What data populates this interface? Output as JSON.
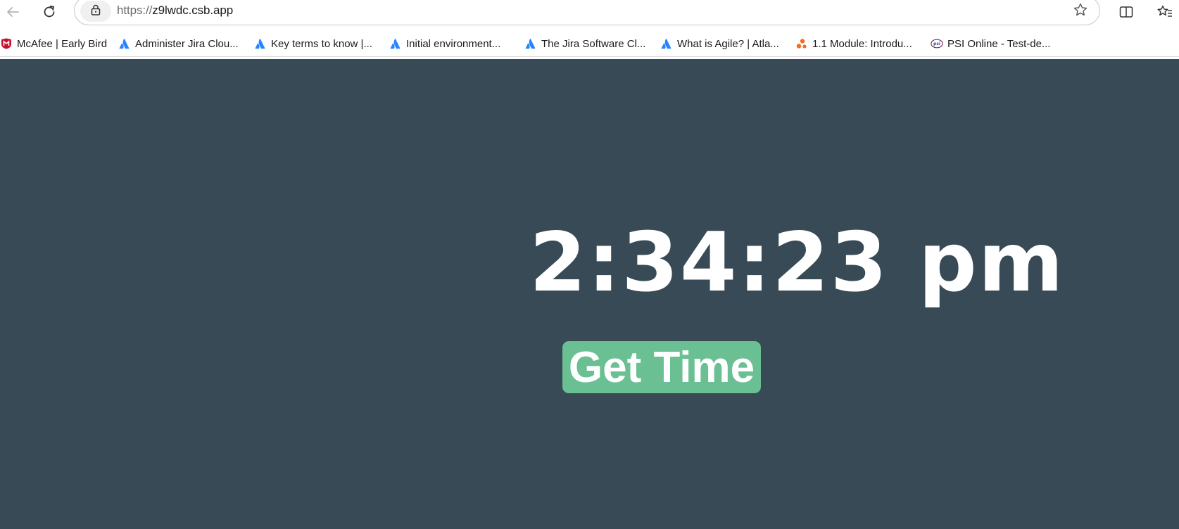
{
  "browser": {
    "url_scheme": "https://",
    "url_host": "z9lwdc.csb.app"
  },
  "bookmarks": [
    {
      "label": "McAfee | Early Bird",
      "icon": "mcafee-icon",
      "color": "#c8102e"
    },
    {
      "label": "Administer Jira Clou...",
      "icon": "atlassian-icon",
      "color": "#2684ff"
    },
    {
      "label": "Key terms to know |...",
      "icon": "atlassian-icon",
      "color": "#2684ff"
    },
    {
      "label": "Initial environment...",
      "icon": "atlassian-icon",
      "color": "#2684ff"
    },
    {
      "label": "The Jira Software Cl...",
      "icon": "atlassian-icon",
      "color": "#2684ff"
    },
    {
      "label": "What is Agile? | Atla...",
      "icon": "atlassian-icon",
      "color": "#2684ff"
    },
    {
      "label": "1.1 Module: Introdu...",
      "icon": "module-icon",
      "color": "#f26b21"
    },
    {
      "label": "PSI Online - Test-de...",
      "icon": "psi-icon",
      "color": "#7a2a5a"
    }
  ],
  "page": {
    "background": "#374a56",
    "clock_text": "2:34:23 pm",
    "button_label": "Get Time",
    "button_color": "#6abf93"
  }
}
